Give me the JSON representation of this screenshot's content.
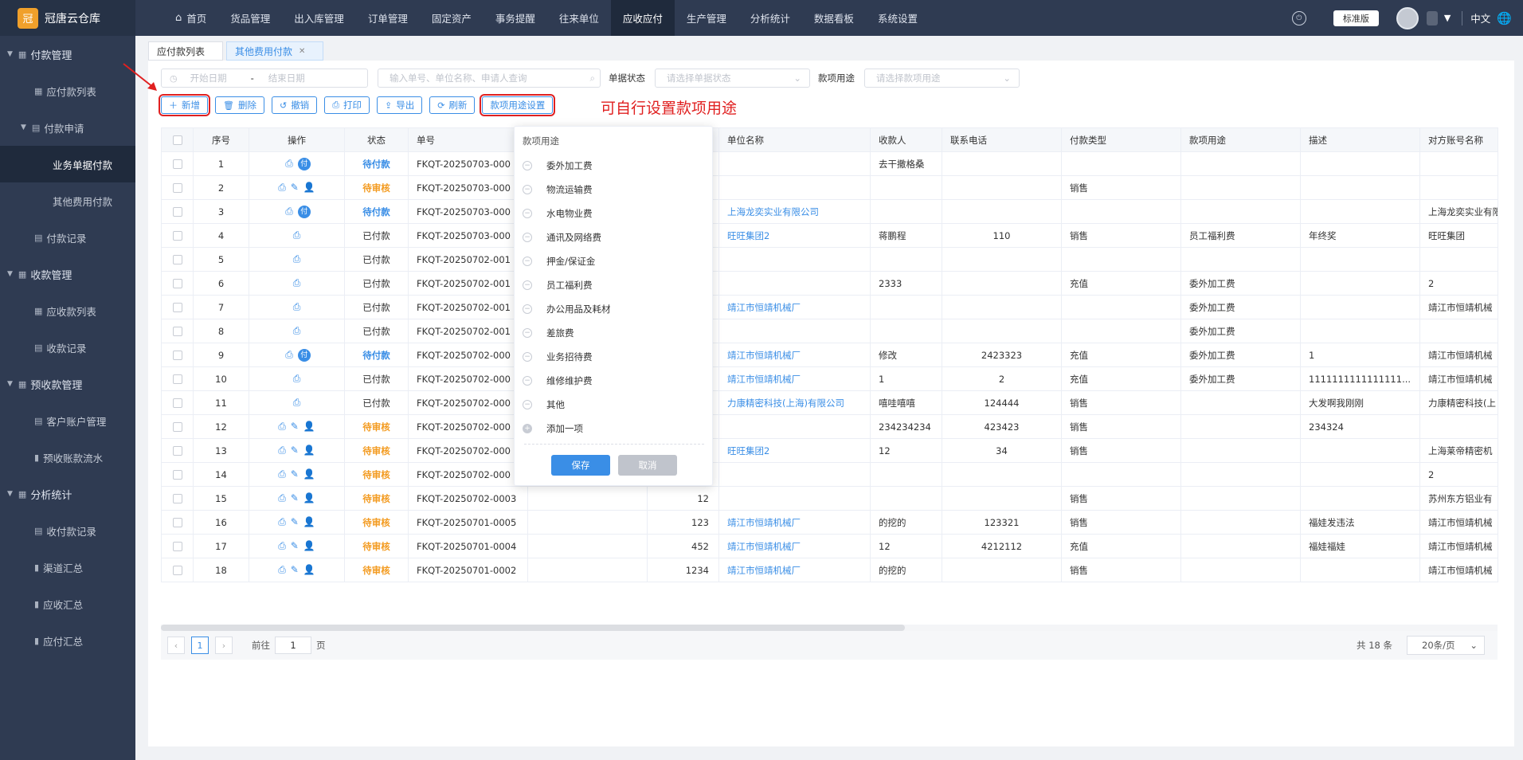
{
  "app": {
    "name": "冠唐云仓库",
    "logo_char": "冠"
  },
  "topnav": {
    "items": [
      "首页",
      "货品管理",
      "出入库管理",
      "订单管理",
      "固定资产",
      "事务提醒",
      "往来单位",
      "应收应付",
      "生产管理",
      "分析统计",
      "数据看板",
      "系统设置"
    ],
    "active_index": 7,
    "edition": "标准版",
    "lang": "中文"
  },
  "sidebar": {
    "items": [
      {
        "type": "group",
        "label": "付款管理"
      },
      {
        "type": "item",
        "label": "应付款列表",
        "level": 1,
        "icon": "grid-icon"
      },
      {
        "type": "group2",
        "label": "付款申请",
        "level": 1,
        "icon": "doc-icon"
      },
      {
        "type": "item",
        "label": "业务单据付款",
        "level": 2,
        "active": true
      },
      {
        "type": "item",
        "label": "其他费用付款",
        "level": 2
      },
      {
        "type": "item",
        "label": "付款记录",
        "level": 1,
        "icon": "doc-icon"
      },
      {
        "type": "group",
        "label": "收款管理"
      },
      {
        "type": "item",
        "label": "应收款列表",
        "level": 1,
        "icon": "grid-icon"
      },
      {
        "type": "item",
        "label": "收款记录",
        "level": 1,
        "icon": "doc-icon"
      },
      {
        "type": "group",
        "label": "预收款管理"
      },
      {
        "type": "item",
        "label": "客户账户管理",
        "level": 1,
        "icon": "doc-icon"
      },
      {
        "type": "item",
        "label": "预收账款流水",
        "level": 1,
        "icon": "chart-icon"
      },
      {
        "type": "group",
        "label": "分析统计"
      },
      {
        "type": "item",
        "label": "收付款记录",
        "level": 1,
        "icon": "doc-icon"
      },
      {
        "type": "item",
        "label": "渠道汇总",
        "level": 1,
        "icon": "chart-icon"
      },
      {
        "type": "item",
        "label": "应收汇总",
        "level": 1,
        "icon": "chart-icon"
      },
      {
        "type": "item",
        "label": "应付汇总",
        "level": 1,
        "icon": "chart-icon"
      }
    ]
  },
  "tabs": [
    {
      "label": "应付款列表",
      "active": false,
      "closable": false
    },
    {
      "label": "其他费用付款",
      "active": true,
      "closable": true
    }
  ],
  "filters": {
    "start_placeholder": "开始日期",
    "end_placeholder": "结束日期",
    "date_sep": "-",
    "search_placeholder": "输入单号、单位名称、申请人查询",
    "status_label": "单据状态",
    "status_placeholder": "请选择单据状态",
    "purpose_label": "款项用途",
    "purpose_placeholder": "请选择款项用途"
  },
  "toolbar": {
    "add": "新增",
    "delete": "删除",
    "revoke": "撤销",
    "print": "打印",
    "export": "导出",
    "refresh": "刷新",
    "purpose_settings": "款项用途设置"
  },
  "annotation": "可自行设置款项用途",
  "table": {
    "headers": [
      "序号",
      "操作",
      "状态",
      "单号",
      "",
      "",
      "单位名称",
      "收款人",
      "联系电话",
      "付款类型",
      "款项用途",
      "描述",
      "对方账号名称"
    ],
    "rows": [
      {
        "no": "1",
        "ops": [
          "print",
          "pay"
        ],
        "status": "待付款",
        "order": "FKQT-20250703-000",
        "amount": "",
        "unit": "",
        "payee": "去干撒格桑",
        "phone": "",
        "type": "",
        "purpose": "",
        "desc": "",
        "account": ""
      },
      {
        "no": "2",
        "ops": [
          "print",
          "edit",
          "user"
        ],
        "status": "待审核",
        "order": "FKQT-20250703-000",
        "amount": "",
        "unit": "",
        "payee": "",
        "phone": "",
        "type": "销售",
        "purpose": "",
        "desc": "",
        "account": ""
      },
      {
        "no": "3",
        "ops": [
          "print",
          "pay"
        ],
        "status": "待付款",
        "order": "FKQT-20250703-000",
        "amount": "",
        "unit": "上海龙奕实业有限公司",
        "payee": "",
        "phone": "",
        "type": "",
        "purpose": "",
        "desc": "",
        "account": "上海龙奕实业有限"
      },
      {
        "no": "4",
        "ops": [
          "print"
        ],
        "status": "已付款",
        "order": "FKQT-20250703-000",
        "amount": "",
        "unit": "旺旺集团2",
        "payee": "蒋鹏程",
        "phone": "110",
        "type": "销售",
        "purpose": "员工福利费",
        "desc": "年终奖",
        "account": "旺旺集团"
      },
      {
        "no": "5",
        "ops": [
          "print"
        ],
        "status": "已付款",
        "order": "FKQT-20250702-001",
        "amount": "",
        "unit": "",
        "payee": "",
        "phone": "",
        "type": "",
        "purpose": "",
        "desc": "",
        "account": ""
      },
      {
        "no": "6",
        "ops": [
          "print"
        ],
        "status": "已付款",
        "order": "FKQT-20250702-001",
        "amount": "",
        "unit": "",
        "payee": "2333",
        "phone": "",
        "type": "充值",
        "purpose": "委外加工费",
        "desc": "",
        "account": "2"
      },
      {
        "no": "7",
        "ops": [
          "print"
        ],
        "status": "已付款",
        "order": "FKQT-20250702-001",
        "amount": "",
        "unit": "靖江市恒靖机械厂",
        "payee": "",
        "phone": "",
        "type": "",
        "purpose": "委外加工费",
        "desc": "",
        "account": "靖江市恒靖机械"
      },
      {
        "no": "8",
        "ops": [
          "print"
        ],
        "status": "已付款",
        "order": "FKQT-20250702-001",
        "amount": "",
        "unit": "",
        "payee": "",
        "phone": "",
        "type": "",
        "purpose": "委外加工费",
        "desc": "",
        "account": ""
      },
      {
        "no": "9",
        "ops": [
          "print",
          "pay"
        ],
        "status": "待付款",
        "order": "FKQT-20250702-000",
        "amount": "",
        "unit": "靖江市恒靖机械厂",
        "payee": "修改",
        "phone": "2423323",
        "type": "充值",
        "purpose": "委外加工费",
        "desc": "1",
        "account": "靖江市恒靖机械"
      },
      {
        "no": "10",
        "ops": [
          "print"
        ],
        "status": "已付款",
        "order": "FKQT-20250702-000",
        "amount": "",
        "unit": "靖江市恒靖机械厂",
        "payee": "1",
        "phone": "2",
        "type": "充值",
        "purpose": "委外加工费",
        "desc": "1111111111111111...",
        "account": "靖江市恒靖机械"
      },
      {
        "no": "11",
        "ops": [
          "print"
        ],
        "status": "已付款",
        "order": "FKQT-20250702-000",
        "amount": "",
        "unit": "力康精密科技(上海)有限公司",
        "payee": "嘻哇嘻嘻",
        "phone": "124444",
        "type": "销售",
        "purpose": "",
        "desc": "大发啊我刚刚",
        "account": "力康精密科技(上"
      },
      {
        "no": "12",
        "ops": [
          "print",
          "edit",
          "user"
        ],
        "status": "待审核",
        "order": "FKQT-20250702-000",
        "amount": "",
        "unit": "",
        "payee": "234234234",
        "phone": "423423",
        "type": "销售",
        "purpose": "",
        "desc": "234324",
        "account": ""
      },
      {
        "no": "13",
        "ops": [
          "print",
          "edit",
          "user"
        ],
        "status": "待审核",
        "order": "FKQT-20250702-000",
        "amount": "",
        "unit": "旺旺集团2",
        "payee": "12",
        "phone": "34",
        "type": "销售",
        "purpose": "",
        "desc": "",
        "account": "上海莱帝精密机"
      },
      {
        "no": "14",
        "ops": [
          "print",
          "edit",
          "user"
        ],
        "status": "待审核",
        "order": "FKQT-20250702-000",
        "amount": "",
        "unit": "",
        "payee": "",
        "phone": "",
        "type": "",
        "purpose": "",
        "desc": "",
        "account": "2"
      },
      {
        "no": "15",
        "ops": [
          "print",
          "edit",
          "user"
        ],
        "status": "待审核",
        "order": "FKQT-20250702-0003",
        "amount": "12",
        "unit": "",
        "payee": "",
        "phone": "",
        "type": "销售",
        "purpose": "",
        "desc": "",
        "account": "苏州东方铝业有"
      },
      {
        "no": "16",
        "ops": [
          "print",
          "edit",
          "user"
        ],
        "status": "待审核",
        "order": "FKQT-20250701-0005",
        "amount": "123",
        "unit": "靖江市恒靖机械厂",
        "payee": "的挖的",
        "phone": "123321",
        "type": "销售",
        "purpose": "",
        "desc": "福娃发违法",
        "account": "靖江市恒靖机械"
      },
      {
        "no": "17",
        "ops": [
          "print",
          "edit",
          "user"
        ],
        "status": "待审核",
        "order": "FKQT-20250701-0004",
        "amount": "452",
        "unit": "靖江市恒靖机械厂",
        "payee": "12",
        "phone": "4212112",
        "type": "充值",
        "purpose": "",
        "desc": "福娃福娃",
        "account": "靖江市恒靖机械"
      },
      {
        "no": "18",
        "ops": [
          "print",
          "edit",
          "user"
        ],
        "status": "待审核",
        "order": "FKQT-20250701-0002",
        "amount": "1234",
        "unit": "靖江市恒靖机械厂",
        "payee": "的挖的",
        "phone": "",
        "type": "销售",
        "purpose": "",
        "desc": "",
        "account": "靖江市恒靖机械"
      }
    ]
  },
  "popup": {
    "title": "款项用途",
    "items": [
      "委外加工费",
      "物流运输费",
      "水电物业费",
      "通讯及网络费",
      "押金/保证金",
      "员工福利费",
      "办公用品及耗材",
      "差旅费",
      "业务招待费",
      "维修维护费",
      "其他"
    ],
    "add_label": "添加一项",
    "save": "保存",
    "cancel": "取消"
  },
  "pagination": {
    "current": "1",
    "goto_label": "前往",
    "goto_value": "1",
    "page_unit": "页",
    "total": "共 18 条",
    "page_size": "20条/页"
  },
  "colors": {
    "nav_bg": "#2f3b52",
    "accent": "#3a8ee6",
    "pending_audit": "#f39a1e",
    "annotation": "#e02020"
  }
}
